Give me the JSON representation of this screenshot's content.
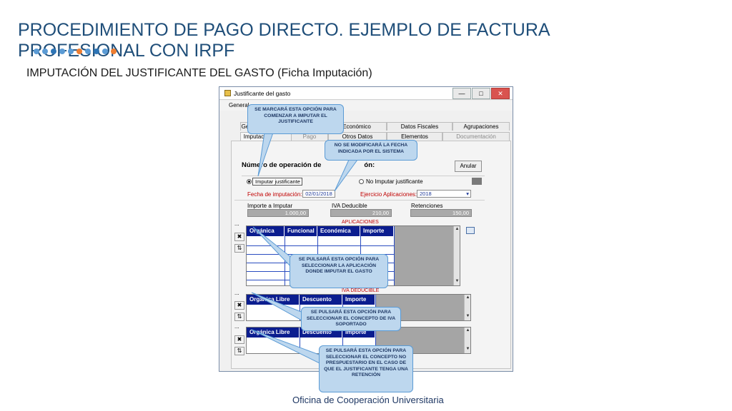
{
  "slide": {
    "title": "PROCEDIMIENTO DE PAGO DIRECTO. EJEMPLO DE FACTURA PROFESIONAL CON IRPF",
    "subtitle": "IMPUTACIÓN DEL JUSTIFICANTE DEL GASTO (Ficha Imputación)",
    "footer": "Oficina de Cooperación Universitaria",
    "dot_colors": [
      "#5b9bd5",
      "#5b9bd5",
      "#2e75b6",
      "#5b9bd5",
      "#5b9bd5",
      "#ed7d31",
      "#5b9bd5",
      "#2e75b6",
      "#5b9bd5",
      "#ed7d31"
    ]
  },
  "window": {
    "title": "Justificante del gasto",
    "minimize_label": "—",
    "maximize_label": "□",
    "close_label": "✕",
    "menu_general": "General",
    "tabs_row1": [
      "Ge",
      "Económico",
      "Datos Fiscales",
      "Agrupaciones"
    ],
    "tabs_row2": [
      "Imputac",
      "Pago",
      "Otros Datos",
      "Elementos",
      "Documentación"
    ],
    "operation_title": "Número de operación de",
    "operation_title_tail": "ón:",
    "cancel_button": "Anular",
    "radio_imputar": "Imputar justificante",
    "radio_no_imputar": "No Imputar justificante",
    "fecha_label": "Fecha de imputación:",
    "fecha_value": "02/01/2018",
    "ejercicio_label": "Ejercicio Aplicaciones:",
    "ejercicio_value": "2018",
    "importe_label": "Importe a Imputar",
    "importe_value": "1.000,00",
    "iva_label": "IVA Deducible",
    "iva_value": "210,00",
    "retenciones_label": "Retenciones",
    "retenciones_value": "150,00",
    "aplicaciones_caption": "APLICACIONES",
    "aplicaciones_headers": [
      "Orgánica",
      "Funcional",
      "Económica",
      "Importe"
    ],
    "iva_caption": "IVA DEDUCIBLE",
    "iva_headers": [
      "Orgánica Libre",
      "Descuento",
      "Importe"
    ],
    "ret_headers": [
      "Orgánica Libre",
      "Descuento",
      "Importe"
    ],
    "ellipsis": "...",
    "delete_glyph": "✖",
    "sort_glyph": "⇅",
    "scroll_up": "▲",
    "scroll_down": "▼",
    "dropdown_arrow": "▾"
  },
  "callouts": {
    "imputar": "SE MARCARÁ ESTA OPCIÓN PARA COMENZAR A IMPUTAR EL JUSTIFICANTE",
    "fecha": "NO SE MODIFICARÁ LA FECHA INDICADA POR EL SISTEMA",
    "aplicacion": "SE PULSARÁ ESTA OPCIÓN PARA SELECCIONAR LA APLICACIÓN DONDE IMPUTAR EL GASTO",
    "iva": "SE PULSARÁ ESTA OPCIÓN PARA SELECCIONAR EL CONCEPTO DE IVA SOPORTADO",
    "retencion": "SE PULSARÁ ESTA OPCIÓN PARA SELECCIONAR EL CONCEPTO NO PRESPUESTARIO EN EL CASO DE QUE EL JUSTIFICANTE TENGA UNA RETENCIÓN"
  }
}
